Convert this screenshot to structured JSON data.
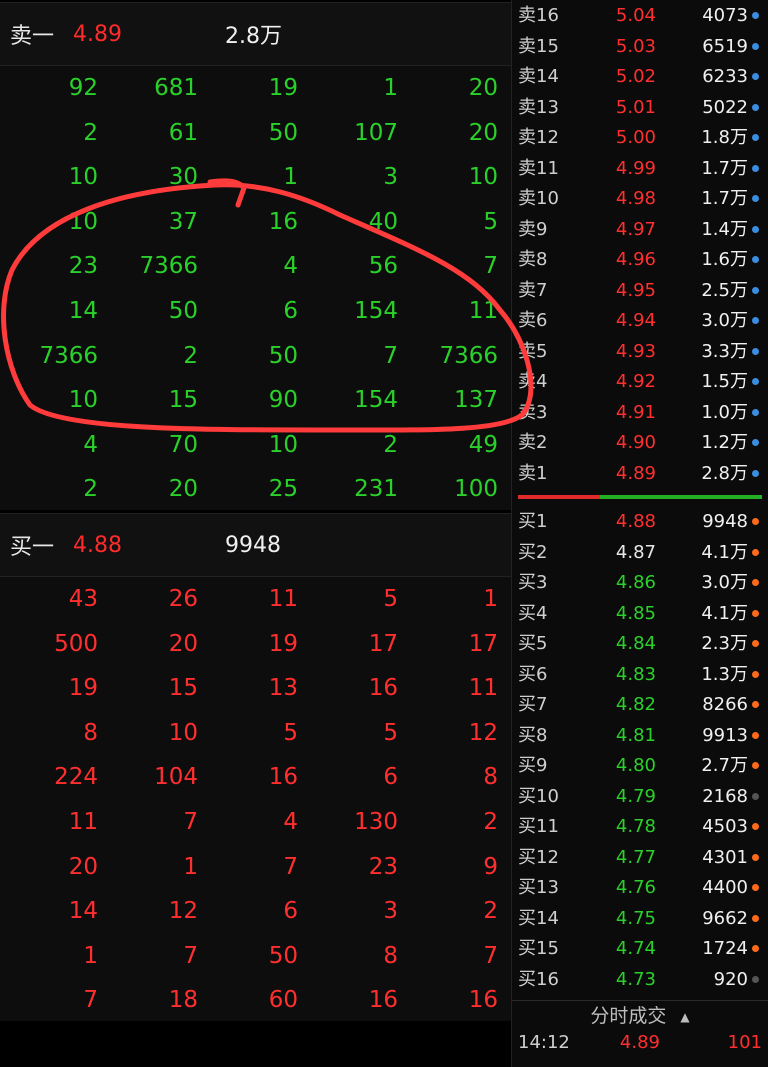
{
  "sell_header": {
    "label": "卖一",
    "price": "4.89",
    "volume": "2.8万"
  },
  "buy_header": {
    "label": "买一",
    "price": "4.88",
    "volume": "9948"
  },
  "sell_queue": [
    [
      "92",
      "681",
      "19",
      "1",
      "20"
    ],
    [
      "2",
      "61",
      "50",
      "107",
      "20"
    ],
    [
      "10",
      "30",
      "1",
      "3",
      "10"
    ],
    [
      "10",
      "37",
      "16",
      "40",
      "5"
    ],
    [
      "23",
      "7366",
      "4",
      "56",
      "7"
    ],
    [
      "14",
      "50",
      "6",
      "154",
      "11"
    ],
    [
      "7366",
      "2",
      "50",
      "7",
      "7366"
    ],
    [
      "10",
      "15",
      "90",
      "154",
      "137"
    ],
    [
      "4",
      "70",
      "10",
      "2",
      "49"
    ],
    [
      "2",
      "20",
      "25",
      "231",
      "100"
    ]
  ],
  "buy_queue": [
    [
      "43",
      "26",
      "11",
      "5",
      "1"
    ],
    [
      "500",
      "20",
      "19",
      "17",
      "17"
    ],
    [
      "19",
      "15",
      "13",
      "16",
      "11"
    ],
    [
      "8",
      "10",
      "5",
      "5",
      "12"
    ],
    [
      "224",
      "104",
      "16",
      "6",
      "8"
    ],
    [
      "11",
      "7",
      "4",
      "130",
      "2"
    ],
    [
      "20",
      "1",
      "7",
      "23",
      "9"
    ],
    [
      "14",
      "12",
      "6",
      "3",
      "2"
    ],
    [
      "1",
      "7",
      "50",
      "8",
      "7"
    ],
    [
      "7",
      "18",
      "60",
      "16",
      "16"
    ]
  ],
  "sell_levels": [
    {
      "label": "卖16",
      "price": "5.04",
      "volume": "4073"
    },
    {
      "label": "卖15",
      "price": "5.03",
      "volume": "6519"
    },
    {
      "label": "卖14",
      "price": "5.02",
      "volume": "6233"
    },
    {
      "label": "卖13",
      "price": "5.01",
      "volume": "5022"
    },
    {
      "label": "卖12",
      "price": "5.00",
      "volume": "1.8万"
    },
    {
      "label": "卖11",
      "price": "4.99",
      "volume": "1.7万"
    },
    {
      "label": "卖10",
      "price": "4.98",
      "volume": "1.7万"
    },
    {
      "label": "卖9",
      "price": "4.97",
      "volume": "1.4万"
    },
    {
      "label": "卖8",
      "price": "4.96",
      "volume": "1.6万"
    },
    {
      "label": "卖7",
      "price": "4.95",
      "volume": "2.5万"
    },
    {
      "label": "卖6",
      "price": "4.94",
      "volume": "3.0万"
    },
    {
      "label": "卖5",
      "price": "4.93",
      "volume": "3.3万"
    },
    {
      "label": "卖4",
      "price": "4.92",
      "volume": "1.5万"
    },
    {
      "label": "卖3",
      "price": "4.91",
      "volume": "1.0万"
    },
    {
      "label": "卖2",
      "price": "4.90",
      "volume": "1.2万"
    },
    {
      "label": "卖1",
      "price": "4.89",
      "volume": "2.8万"
    }
  ],
  "buy_levels": [
    {
      "label": "买1",
      "price": "4.88",
      "volume": "9948",
      "price_color": "red",
      "dot": "orange"
    },
    {
      "label": "买2",
      "price": "4.87",
      "volume": "4.1万",
      "price_color": "white",
      "dot": "orange"
    },
    {
      "label": "买3",
      "price": "4.86",
      "volume": "3.0万",
      "price_color": "green",
      "dot": "orange"
    },
    {
      "label": "买4",
      "price": "4.85",
      "volume": "4.1万",
      "price_color": "green",
      "dot": "orange"
    },
    {
      "label": "买5",
      "price": "4.84",
      "volume": "2.3万",
      "price_color": "green",
      "dot": "orange"
    },
    {
      "label": "买6",
      "price": "4.83",
      "volume": "1.3万",
      "price_color": "green",
      "dot": "orange"
    },
    {
      "label": "买7",
      "price": "4.82",
      "volume": "8266",
      "price_color": "green",
      "dot": "orange"
    },
    {
      "label": "买8",
      "price": "4.81",
      "volume": "9913",
      "price_color": "green",
      "dot": "orange"
    },
    {
      "label": "买9",
      "price": "4.80",
      "volume": "2.7万",
      "price_color": "green",
      "dot": "orange"
    },
    {
      "label": "买10",
      "price": "4.79",
      "volume": "2168",
      "price_color": "green",
      "dot": "gray"
    },
    {
      "label": "买11",
      "price": "4.78",
      "volume": "4503",
      "price_color": "green",
      "dot": "orange"
    },
    {
      "label": "买12",
      "price": "4.77",
      "volume": "4301",
      "price_color": "green",
      "dot": "orange"
    },
    {
      "label": "买13",
      "price": "4.76",
      "volume": "4400",
      "price_color": "green",
      "dot": "orange"
    },
    {
      "label": "买14",
      "price": "4.75",
      "volume": "9662",
      "price_color": "green",
      "dot": "orange"
    },
    {
      "label": "买15",
      "price": "4.74",
      "volume": "1724",
      "price_color": "green",
      "dot": "orange"
    },
    {
      "label": "买16",
      "price": "4.73",
      "volume": "920",
      "price_color": "green",
      "dot": "gray"
    }
  ],
  "trades_header": "分时成交",
  "trades": [
    {
      "time": "14:12",
      "price": "4.89",
      "volume": "101"
    }
  ],
  "colors": {
    "up": "#ff2f2f",
    "down": "#2bd12b",
    "highlight_circle": "#ff3b3b"
  }
}
